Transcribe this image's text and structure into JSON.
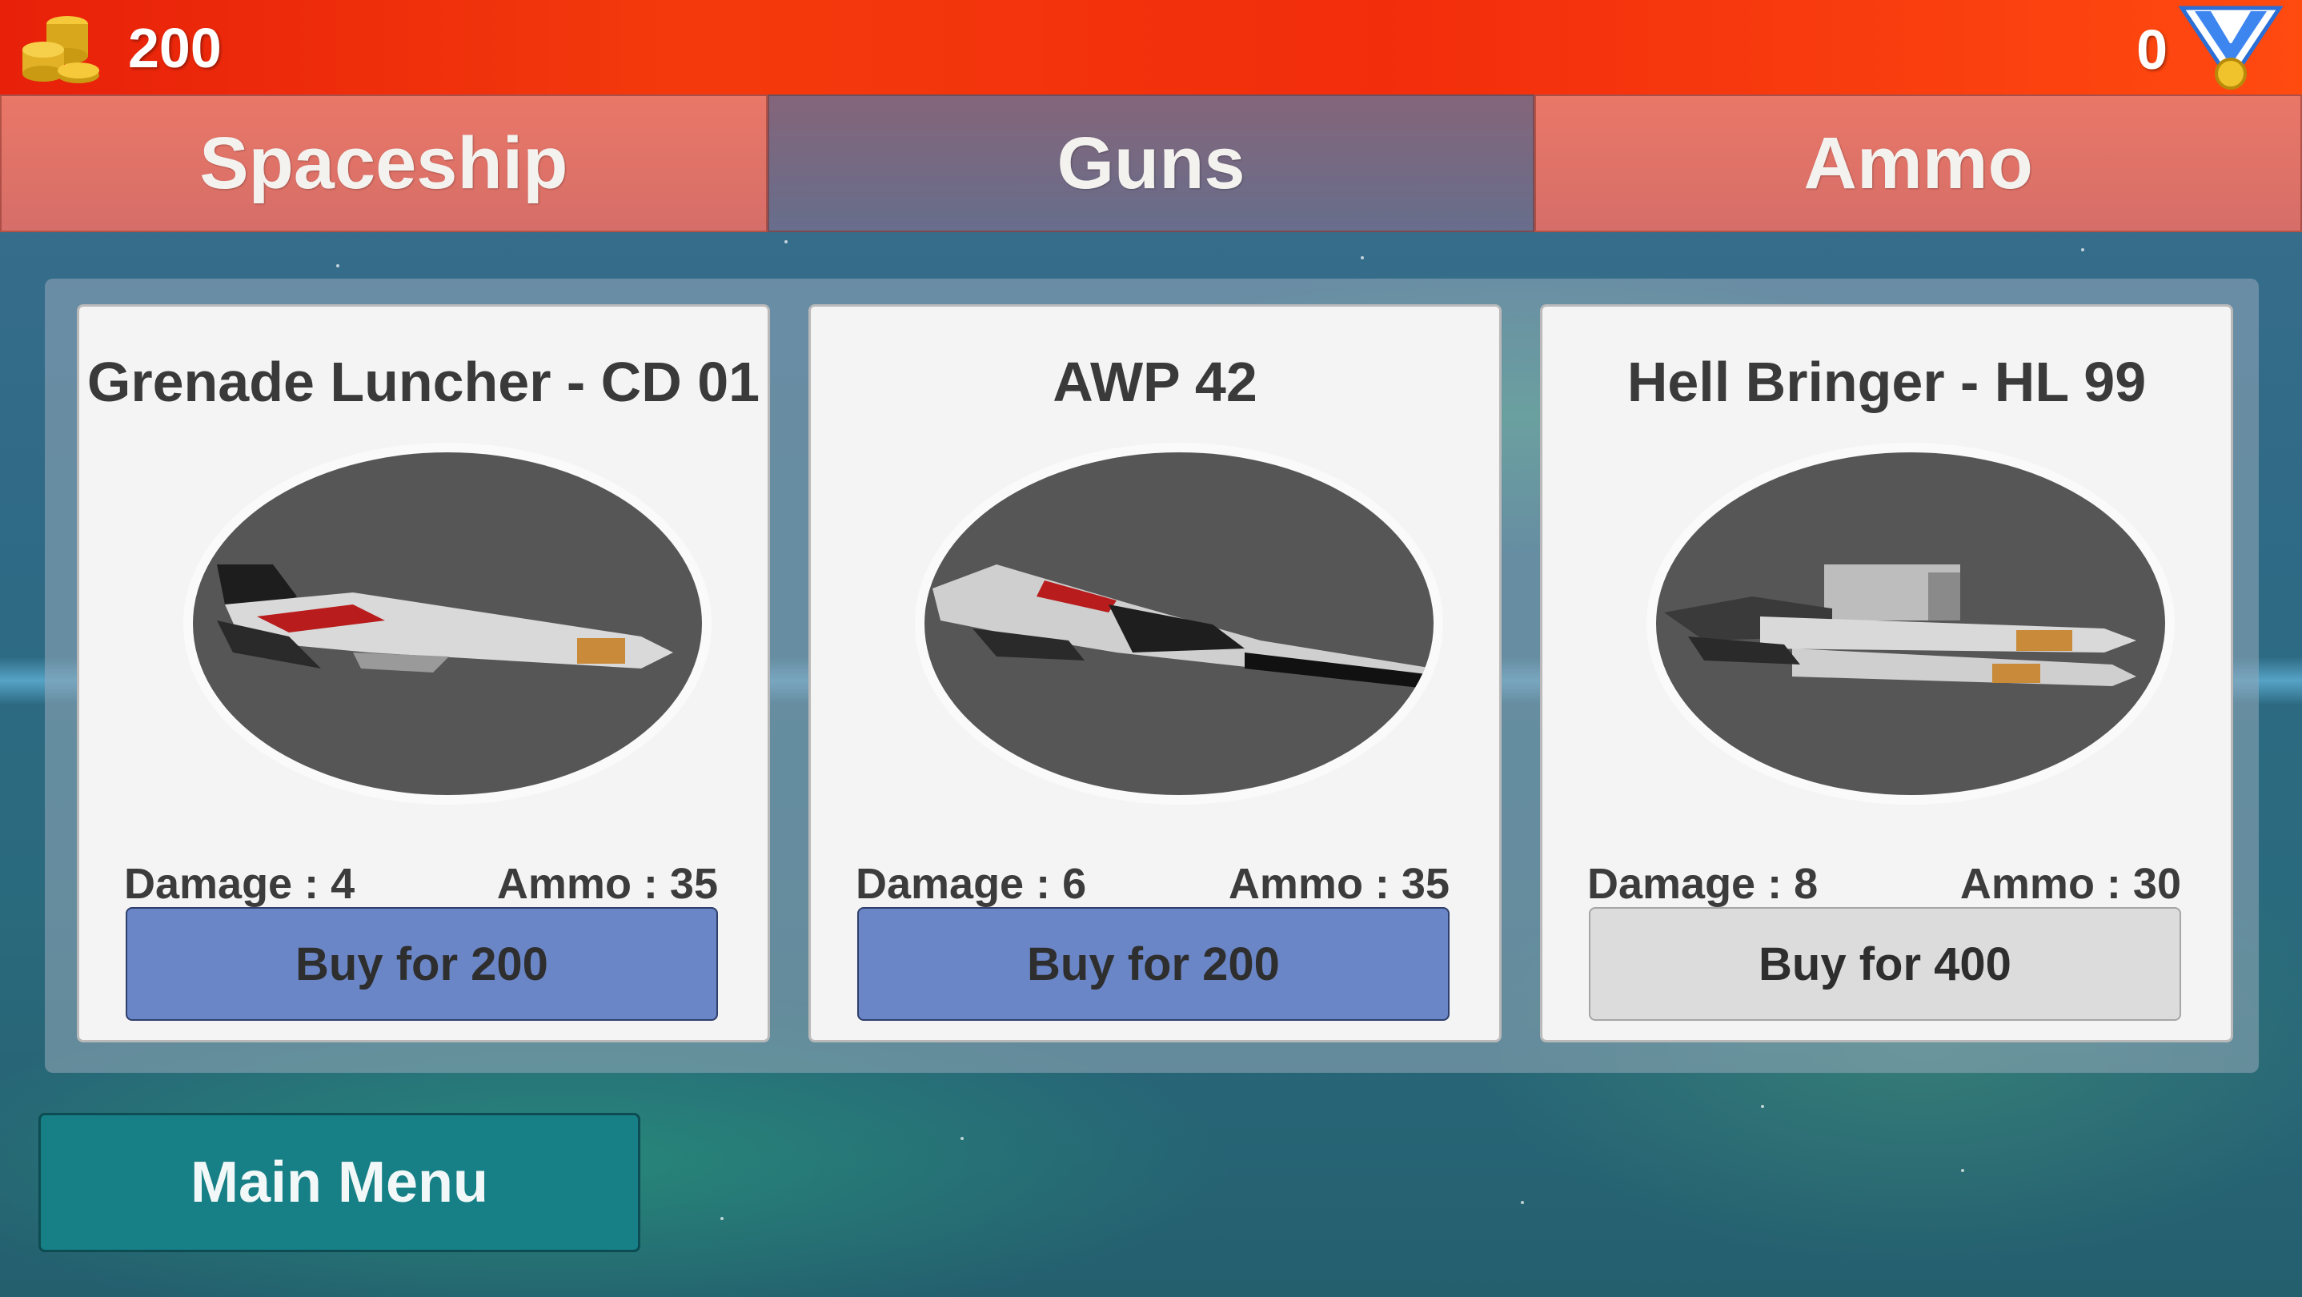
{
  "header": {
    "coins": "200",
    "medals": "0"
  },
  "tabs": [
    {
      "label": "Spaceship",
      "active": false
    },
    {
      "label": "Guns",
      "active": true
    },
    {
      "label": "Ammo",
      "active": false
    }
  ],
  "items": [
    {
      "title": "Grenade Luncher - CD 01",
      "damage": "Damage : 4",
      "ammo": "Ammo : 35",
      "buy_label": "Buy for 200",
      "affordable": true
    },
    {
      "title": "AWP 42",
      "damage": "Damage : 6",
      "ammo": "Ammo : 35",
      "buy_label": "Buy for 200",
      "affordable": true
    },
    {
      "title": "Hell Bringer - HL 99",
      "damage": "Damage : 8",
      "ammo": "Ammo : 30",
      "buy_label": "Buy for 400",
      "affordable": false
    }
  ],
  "footer": {
    "main_menu_label": "Main Menu"
  },
  "icons": {
    "coins": "coins-icon",
    "medal": "medal-icon"
  },
  "colors": {
    "topbar": "#f22d0c",
    "buy_enabled": "#6b86c7",
    "buy_disabled": "#dcdcdc",
    "main_menu": "#177f86"
  }
}
